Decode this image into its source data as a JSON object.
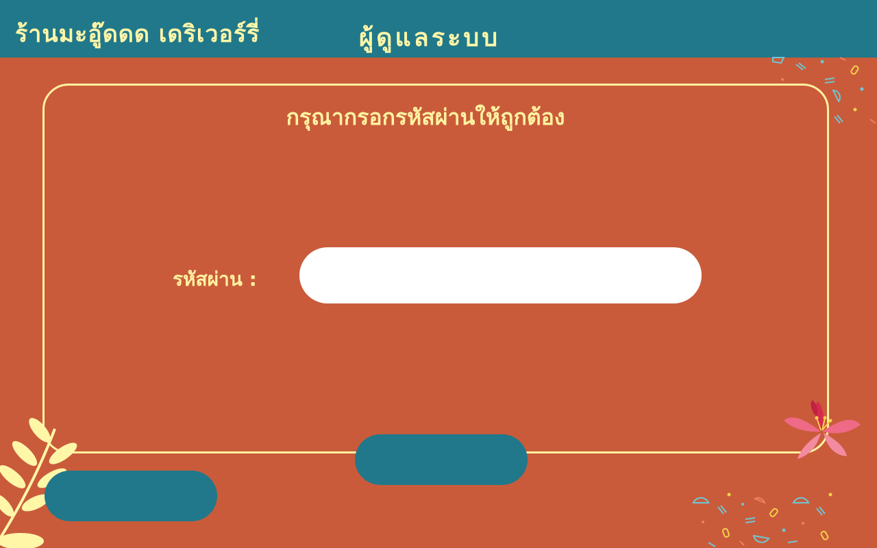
{
  "header": {
    "shop_name": "ร้านมะอู๊ดดด เดริเวอร์รี่",
    "page_title": "ผู้ดูแลระบบ"
  },
  "panel": {
    "heading": "กรุณากรอกรหัสผ่านให้ถูกต้อง",
    "password_label": "รหัสผ่าน :",
    "password_value": "",
    "password_placeholder": ""
  },
  "buttons": {
    "submit_label": "",
    "back_label": ""
  },
  "colors": {
    "background": "#c95b3b",
    "header": "#21788a",
    "accent_text": "#fff2a0",
    "button": "#21788a",
    "input_bg": "#ffffff"
  },
  "icons": {
    "confetti_top_right": "confetti-icon",
    "confetti_bottom_right": "confetti-icon",
    "flower": "lily-flower-icon",
    "leaves": "fern-leaf-icon"
  }
}
